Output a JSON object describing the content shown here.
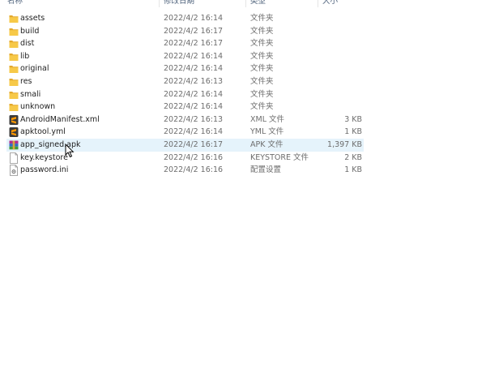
{
  "header": {
    "name": "名称",
    "modified": "修改日期",
    "type": "类型",
    "size": "大小"
  },
  "files": [
    {
      "name": "assets",
      "date": "2022/4/2 16:14",
      "type": "文件夹",
      "size": "",
      "icon": "folder-icon"
    },
    {
      "name": "build",
      "date": "2022/4/2 16:17",
      "type": "文件夹",
      "size": "",
      "icon": "folder-icon"
    },
    {
      "name": "dist",
      "date": "2022/4/2 16:17",
      "type": "文件夹",
      "size": "",
      "icon": "folder-icon"
    },
    {
      "name": "lib",
      "date": "2022/4/2 16:14",
      "type": "文件夹",
      "size": "",
      "icon": "folder-icon"
    },
    {
      "name": "original",
      "date": "2022/4/2 16:14",
      "type": "文件夹",
      "size": "",
      "icon": "folder-icon"
    },
    {
      "name": "res",
      "date": "2022/4/2 16:13",
      "type": "文件夹",
      "size": "",
      "icon": "folder-icon"
    },
    {
      "name": "smali",
      "date": "2022/4/2 16:14",
      "type": "文件夹",
      "size": "",
      "icon": "folder-icon"
    },
    {
      "name": "unknown",
      "date": "2022/4/2 16:14",
      "type": "文件夹",
      "size": "",
      "icon": "folder-icon"
    },
    {
      "name": "AndroidManifest.xml",
      "date": "2022/4/2 16:13",
      "type": "XML 文件",
      "size": "3 KB",
      "icon": "sublime-file-icon"
    },
    {
      "name": "apktool.yml",
      "date": "2022/4/2 16:14",
      "type": "YML 文件",
      "size": "1 KB",
      "icon": "sublime-file-icon"
    },
    {
      "name": "app_signed.apk",
      "date": "2022/4/2 16:17",
      "type": "APK 文件",
      "size": "1,397 KB",
      "icon": "winrar-archive-icon"
    },
    {
      "name": "key.keystore",
      "date": "2022/4/2 16:16",
      "type": "KEYSTORE 文件",
      "size": "2 KB",
      "icon": "blank-file-icon"
    },
    {
      "name": "password.ini",
      "date": "2022/4/2 16:16",
      "type": "配置设置",
      "size": "1 KB",
      "icon": "settings-file-icon"
    }
  ],
  "selected_index": 10,
  "colors": {
    "folder": "#f7c948",
    "folder_dark": "#e3a82b",
    "selection": "#e5f3fb",
    "header_text": "#4c607a"
  }
}
